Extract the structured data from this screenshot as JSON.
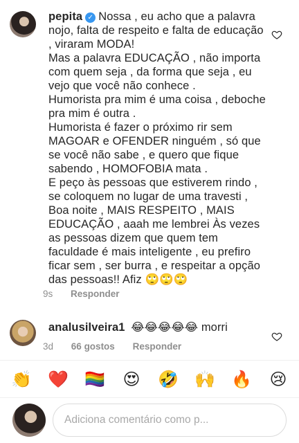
{
  "comments": [
    {
      "username": "pepita",
      "verified": true,
      "paragraphs": [
        "Nossa , eu acho que a palavra nojo, falta de respeito e falta de educação , viraram MODA!",
        "Mas a palavra EDUCAÇÃO , não importa com quem seja , da forma que seja , eu vejo que você não conhece .",
        "Humorista pra mim é uma coisa , deboche pra mim é outra .",
        "Humorista é fazer o próximo rir sem MAGOAR e OFENDER ninguém , só que se você não sabe , e quero que fique sabendo , HOMOFOBIA mata .",
        "E peço às pessoas que estiverem rindo , se coloquem no lugar de uma travesti , Boa noite , MAIS RESPEITO , MAIS EDUCAÇÃO , aaah me lembrei Às vezes as pessoas dizem que quem tem faculdade é mais inteligente , eu prefiro ficar sem , ser burra , e respeitar a opção das pessoas!! Afiz 🙄🙄🙄"
      ],
      "time": "9s",
      "reply": "Responder"
    },
    {
      "username": "analusilveira1",
      "text": "😂😂😂😂😂 morri",
      "time": "3d",
      "likes": "66 gostos",
      "reply": "Responder"
    }
  ],
  "reactions": [
    "👏",
    "❤️",
    "🏳️‍🌈",
    "😍",
    "🤣",
    "🙌",
    "🔥",
    "😢"
  ],
  "comment_input": {
    "placeholder": "Adiciona comentário como p..."
  }
}
